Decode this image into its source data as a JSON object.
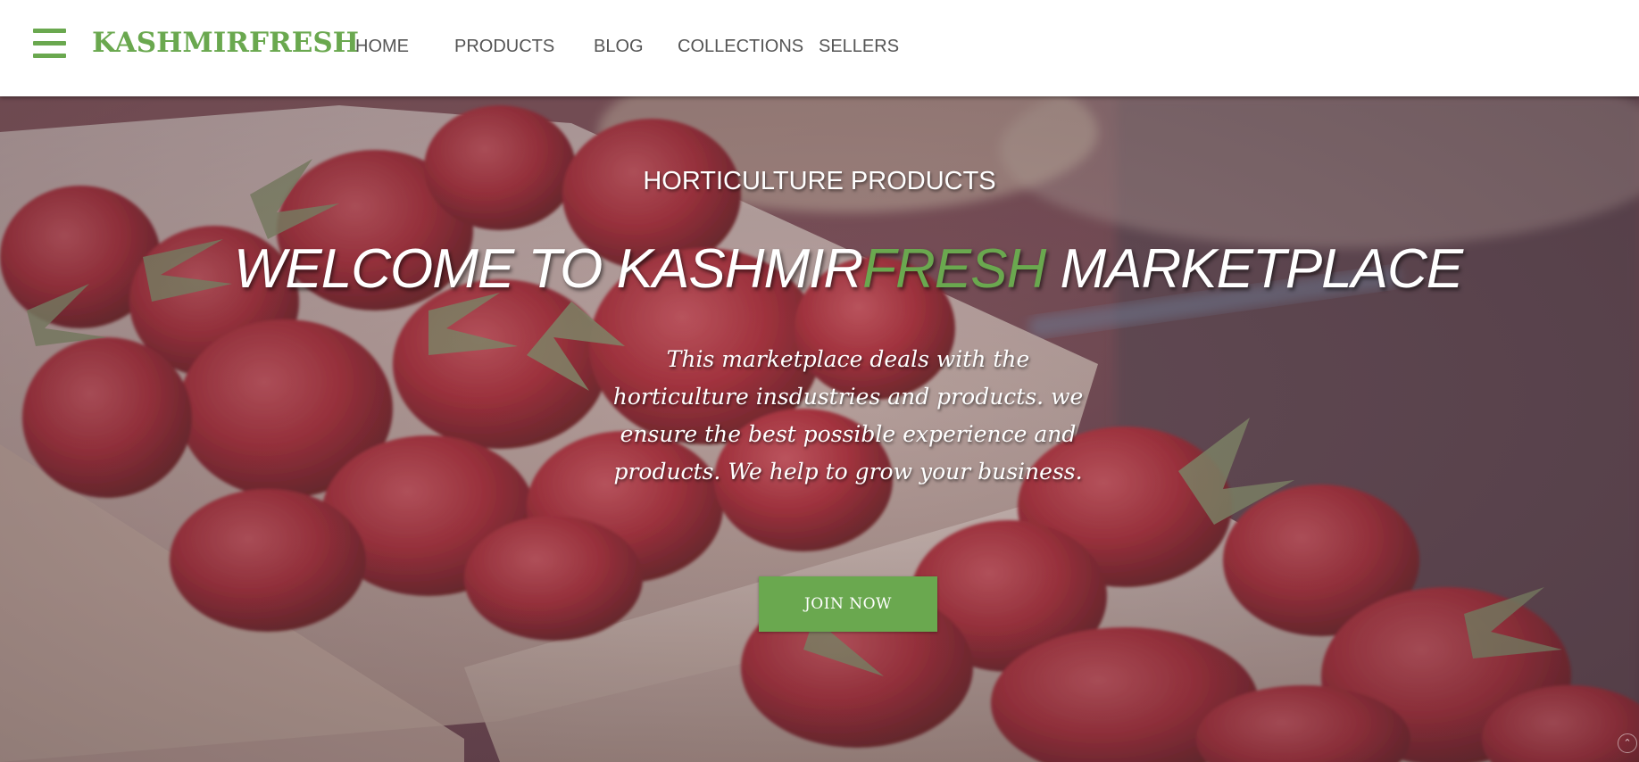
{
  "colors": {
    "brand_green": "#6aa84f",
    "nav_text": "#555555",
    "hero_text": "#ffffff"
  },
  "header": {
    "menu_icon": "hamburger-menu-icon",
    "brand": "KASHMIRFRESH",
    "nav": [
      {
        "label": "HOME"
      },
      {
        "label": "PRODUCTS"
      },
      {
        "label": "BLOG"
      },
      {
        "label": "COLLECTIONS"
      },
      {
        "label": "SELLERS"
      }
    ]
  },
  "hero": {
    "subtitle": "HORTICULTURE PRODUCTS",
    "title_part1": "WELCOME TO KASHMIR",
    "title_highlight": "FRESH",
    "title_part2": " MARKETPLACE",
    "description": "This marketplace deals with the horticulture insdustries and products. we ensure the best possible experience and products. We help to grow your business.",
    "cta_label": "JOIN NOW",
    "scroll_icon": "scroll-up-icon"
  }
}
